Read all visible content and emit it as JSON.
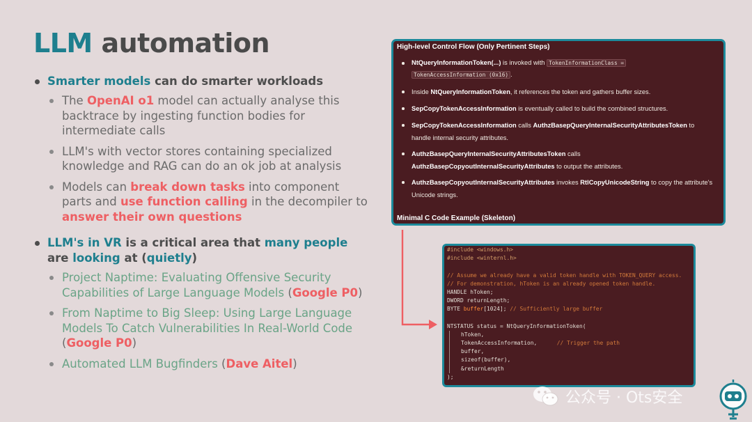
{
  "slide": {
    "title_accent": "LLM",
    "title_rest": "automation"
  },
  "bullets": {
    "b1": {
      "part1": "Smarter models",
      "part2": " can do smarter workloads"
    },
    "b1_sub1": {
      "p1": "The ",
      "p2": "OpenAI o1",
      "p3": " model can actually analyse this backtrace by ingesting function bodies for intermediate calls"
    },
    "b1_sub2": "LLM's with vector stores containing specialized knowledge and RAG can do an ok job at analysis",
    "b1_sub3": {
      "p1": "Models can ",
      "p2": "break down tasks",
      "p3": " into component parts and ",
      "p4": "use function calling",
      "p5": " in the decompiler to ",
      "p6": "answer their own questions"
    },
    "b2": {
      "p1": "LLM's in VR",
      "p2": " is a critical area that ",
      "p3": "many people",
      "p4": " are ",
      "p5": "looking",
      "p6": " at (",
      "p7": "quietly",
      "p8": ")"
    },
    "b2_sub1": {
      "link": "Project Naptime: Evaluating Offensive Security Capabilities of Large Language Models",
      "open": " (",
      "source": "Google P0",
      "close": ")"
    },
    "b2_sub2": {
      "link": "From Naptime to Big Sleep: Using Large Language Models To Catch Vulnerabilities In Real-World Code",
      "open": " (",
      "source": "Google P0",
      "close": ")"
    },
    "b2_sub3": {
      "link": "Automated LLM Bugfinders",
      "open": "  (",
      "source": "Dave Aitel",
      "close": ")"
    }
  },
  "panel": {
    "header": "High-level Control Flow (Only Pertinent Steps)",
    "footer": "Minimal C Code Example (Skeleton)",
    "s1": {
      "b1": "NtQueryInformationToken(...)",
      "t1": " is invoked with ",
      "c1": "TokenInformationClass =",
      "c2": "TokenAccessInformation (0x16)",
      "t2": "."
    },
    "s2": {
      "t1": "Inside ",
      "b1": "NtQueryInformationToken",
      "t2": ", it references the token and gathers buffer sizes."
    },
    "s3": {
      "b1": "SepCopyTokenAccessInformation",
      "t1": " is eventually called to build the combined structures."
    },
    "s4": {
      "b1": "SepCopyTokenAccessInformation",
      "t1": " calls ",
      "b2": "AuthzBasepQueryInternalSecurityAttributesToken",
      "t2": " to handle internal security attributes."
    },
    "s5": {
      "b1": "AuthzBasepQueryInternalSecurityAttributesToken",
      "t1": " calls ",
      "b2": "AuthzBasepCopyoutInternalSecurityAttributes",
      "t2": " to output the attributes."
    },
    "s6": {
      "b1": "AuthzBasepCopyoutInternalSecurityAttributes",
      "t1": " invokes ",
      "b2": "RtlCopyUnicodeString",
      "t2": " to copy the attribute's Unicode strings."
    }
  },
  "code": {
    "l1": "#include <windows.h>",
    "l2": "#include <winternl.h>",
    "l4": "// Assume we already have a valid token handle with TOKEN_QUERY access.",
    "l5": "// For demonstration, hToken is an already opened token handle.",
    "l6": "HANDLE hToken;",
    "l7": "DWORD returnLength;",
    "l8a": "BYTE ",
    "l8b": "buffer",
    "l8c": "[1024]; ",
    "l8d": "// Sufficiently large buffer",
    "l10": "NTSTATUS status = NtQueryInformationToken(",
    "l11": "hToken,",
    "l12a": "TokenAccessInformation,      ",
    "l12b": "// Trigger the path",
    "l13": "buffer,",
    "l14": "sizeof(buffer),",
    "l15": "&returnLength",
    "l16": ");"
  },
  "watermark": {
    "text": "公众号 · Ots安全",
    "icon": "wechat-icon",
    "logo": "robot-logo"
  },
  "colors": {
    "background": "#e3d9da",
    "teal": "#1e7f8e",
    "accent_red": "#ee5f63",
    "link_green": "#6aa487",
    "panel_bg": "#4a1c21",
    "panel_border": "#1c8a9b",
    "arrow": "#ee5f63"
  }
}
